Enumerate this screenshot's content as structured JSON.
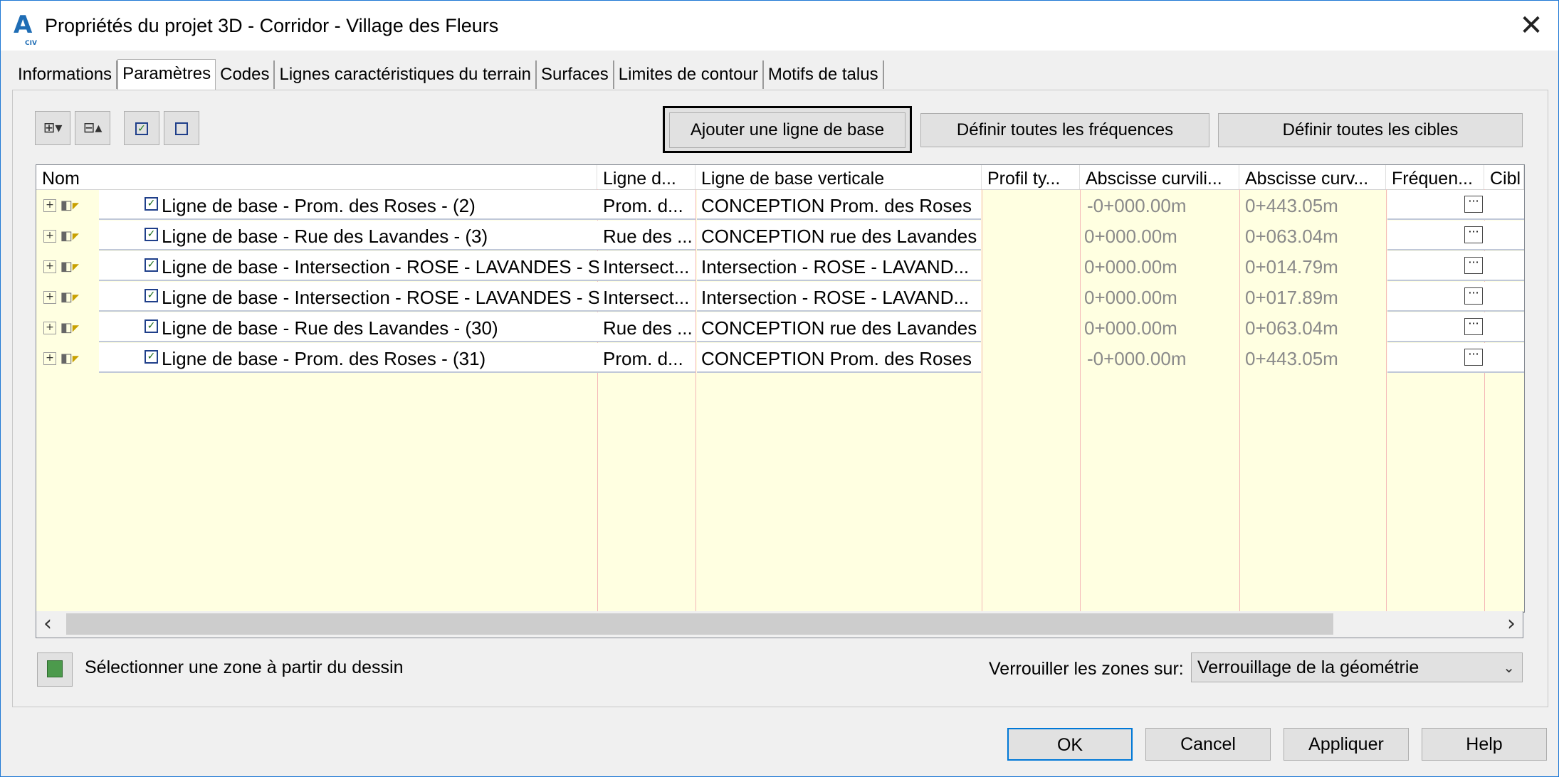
{
  "window": {
    "title": "Propriétés du projet 3D - Corridor - Village des Fleurs",
    "app_icon": "autocad-civil3d-icon",
    "close_glyph": "✕"
  },
  "tabs": [
    {
      "label": "Informations",
      "active": false
    },
    {
      "label": "Paramètres",
      "active": true
    },
    {
      "label": "Codes",
      "active": false
    },
    {
      "label": "Lignes caractéristiques du terrain",
      "active": false
    },
    {
      "label": "Surfaces",
      "active": false
    },
    {
      "label": "Limites de contour",
      "active": false
    },
    {
      "label": "Motifs de talus",
      "active": false
    }
  ],
  "toolbar": {
    "expand_icon": "expand-all-icon",
    "collapse_icon": "collapse-all-icon",
    "check_all_icon": "check-all-icon",
    "uncheck_all_icon": "uncheck-all-icon",
    "add_baseline": "Ajouter une ligne de base",
    "set_all_frequencies": "Définir toutes les fréquences",
    "set_all_targets": "Définir toutes les cibles"
  },
  "grid": {
    "columns": [
      "Nom",
      "Ligne d...",
      "Ligne de base verticale",
      "Profil ty...",
      "Abscisse curvili...",
      "Abscisse curv...",
      "Fréquen...",
      "Cibl"
    ],
    "rows": [
      {
        "name": "Ligne de base - Prom. des Roses - (2)",
        "alignment": "Prom. d...",
        "profile": "CONCEPTION Prom. des Roses",
        "start": "-0+000.00m",
        "end": "0+443.05m",
        "freq": "···"
      },
      {
        "name": "Ligne de base - Rue des Lavandes - (3)",
        "alignment": "Rue des ...",
        "profile": "CONCEPTION rue des Lavandes",
        "start": "0+000.00m",
        "end": "0+063.04m",
        "freq": "···"
      },
      {
        "name": "Ligne de base - Intersection - ROSE - LAVANDES - S...",
        "alignment": "Intersect...",
        "profile": "Intersection - ROSE - LAVAND...",
        "start": "0+000.00m",
        "end": "0+014.79m",
        "freq": "···"
      },
      {
        "name": "Ligne de base - Intersection - ROSE - LAVANDES - S...",
        "alignment": "Intersect...",
        "profile": "Intersection - ROSE - LAVAND...",
        "start": "0+000.00m",
        "end": "0+017.89m",
        "freq": "···"
      },
      {
        "name": "Ligne de base - Rue des Lavandes - (30)",
        "alignment": "Rue des ...",
        "profile": "CONCEPTION rue des Lavandes",
        "start": "0+000.00m",
        "end": "0+063.04m",
        "freq": "···"
      },
      {
        "name": "Ligne de base - Prom. des Roses - (31)",
        "alignment": "Prom. d...",
        "profile": "CONCEPTION Prom. des Roses",
        "start": "-0+000.00m",
        "end": "0+443.05m",
        "freq": "···"
      }
    ]
  },
  "bottom": {
    "select_zone_icon": "select-region-icon",
    "select_zone_label": "Sélectionner une zone à partir du dessin",
    "lock_label": "Verrouiller les zones sur:",
    "lock_value": "Verrouillage de la géométrie"
  },
  "footer": {
    "ok": "OK",
    "cancel": "Cancel",
    "apply": "Appliquer",
    "help": "Help"
  }
}
